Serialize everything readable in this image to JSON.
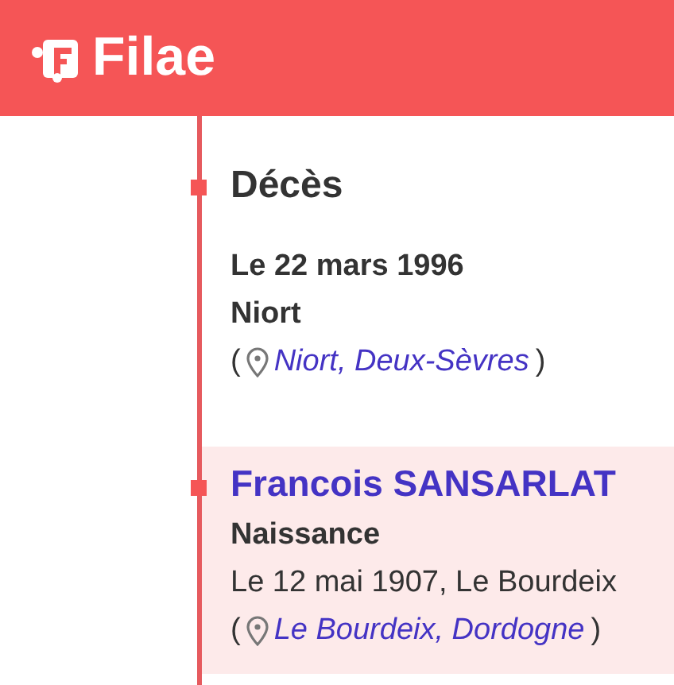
{
  "header": {
    "logo_text": "Filae"
  },
  "timeline": [
    {
      "kind": "event",
      "title": "Décès",
      "lines": [
        {
          "text": "Le 22 mars 1996",
          "bold": true
        },
        {
          "text": "Niort",
          "bold": true
        }
      ],
      "place": {
        "open": "(",
        "name": "Niort, Deux-Sèvres",
        "close": ")"
      }
    },
    {
      "kind": "person",
      "title": "Francois SANSARLAT",
      "lines": [
        {
          "text": "Naissance",
          "bold": true
        },
        {
          "text": "Le 12 mai 1907, Le Bourdeix",
          "bold": false
        }
      ],
      "place": {
        "open": "(",
        "name": "Le Bourdeix, Dordogne",
        "close": ")"
      }
    }
  ]
}
